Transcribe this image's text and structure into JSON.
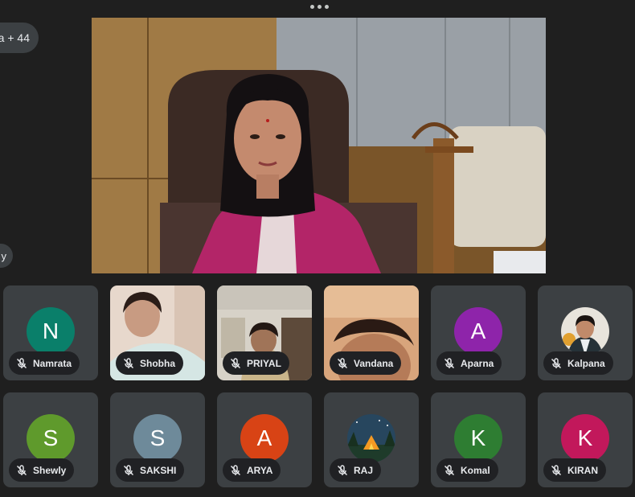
{
  "header": {
    "more_options_icon": "more-horizontal-icon"
  },
  "sidebar": {
    "people_count": "a + 44",
    "side_label": "y"
  },
  "participants": [
    {
      "name": "Namrata",
      "initial": "N",
      "color": "#0a7f6a",
      "muted": true,
      "media": "avatar"
    },
    {
      "name": "Shobha",
      "initial": "",
      "color": "",
      "muted": true,
      "media": "video"
    },
    {
      "name": "PRIYAL",
      "initial": "",
      "color": "",
      "muted": true,
      "media": "video"
    },
    {
      "name": "Vandana",
      "initial": "",
      "color": "",
      "muted": true,
      "media": "video"
    },
    {
      "name": "Aparna",
      "initial": "A",
      "color": "#8e24aa",
      "muted": true,
      "media": "avatar"
    },
    {
      "name": "Kalpana",
      "initial": "",
      "color": "",
      "muted": true,
      "media": "photo"
    },
    {
      "name": "Shewly",
      "initial": "S",
      "color": "#5f9a2c",
      "muted": true,
      "media": "avatar"
    },
    {
      "name": "SAKSHI",
      "initial": "S",
      "color": "#6e8a9a",
      "muted": true,
      "media": "avatar"
    },
    {
      "name": "ARYA",
      "initial": "A",
      "color": "#d84315",
      "muted": true,
      "media": "avatar"
    },
    {
      "name": "RAJ",
      "initial": "",
      "color": "",
      "muted": true,
      "media": "photo"
    },
    {
      "name": "Komal",
      "initial": "K",
      "color": "#2e7d32",
      "muted": true,
      "media": "avatar"
    },
    {
      "name": "KIRAN",
      "initial": "K",
      "color": "#c2185b",
      "muted": true,
      "media": "avatar"
    }
  ],
  "icons": {
    "muted": "mic-off-icon"
  }
}
